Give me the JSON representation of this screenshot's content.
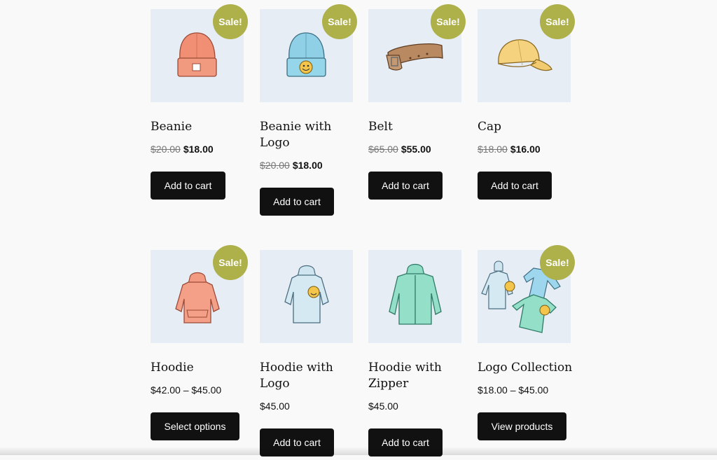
{
  "colors": {
    "sale_badge": "#aeb04a",
    "button_bg": "#111111",
    "image_bg": "#e7edf4",
    "page_bg": "#f9f9f9"
  },
  "products": [
    {
      "name": "Beanie",
      "icon": "coral-beanie-icon",
      "sale": true,
      "sale_label": "Sale!",
      "old_price": "$20.00",
      "price": "$18.00",
      "button": "Add to cart"
    },
    {
      "name": "Beanie with Logo",
      "icon": "blue-beanie-logo-icon",
      "sale": true,
      "sale_label": "Sale!",
      "old_price": "$20.00",
      "price": "$18.00",
      "button": "Add to cart"
    },
    {
      "name": "Belt",
      "icon": "brown-belt-icon",
      "sale": true,
      "sale_label": "Sale!",
      "old_price": "$65.00",
      "price": "$55.00",
      "button": "Add to cart"
    },
    {
      "name": "Cap",
      "icon": "yellow-cap-icon",
      "sale": true,
      "sale_label": "Sale!",
      "old_price": "$18.00",
      "price": "$16.00",
      "button": "Add to cart"
    },
    {
      "name": "Hoodie",
      "icon": "pink-hoodie-icon",
      "sale": true,
      "sale_label": "Sale!",
      "price_range": "$42.00 – $45.00",
      "button": "Select options"
    },
    {
      "name": "Hoodie with Logo",
      "icon": "blue-hoodie-logo-icon",
      "sale": false,
      "price_range": "$45.00",
      "button": "Add to cart"
    },
    {
      "name": "Hoodie with Zipper",
      "icon": "green-zip-hoodie-icon",
      "sale": false,
      "price_range": "$45.00",
      "button": "Add to cart"
    },
    {
      "name": "Logo Collection",
      "icon": "logo-collection-icon",
      "sale": true,
      "sale_label": "Sale!",
      "price_range": "$18.00 – $45.00",
      "button": "View products"
    }
  ]
}
